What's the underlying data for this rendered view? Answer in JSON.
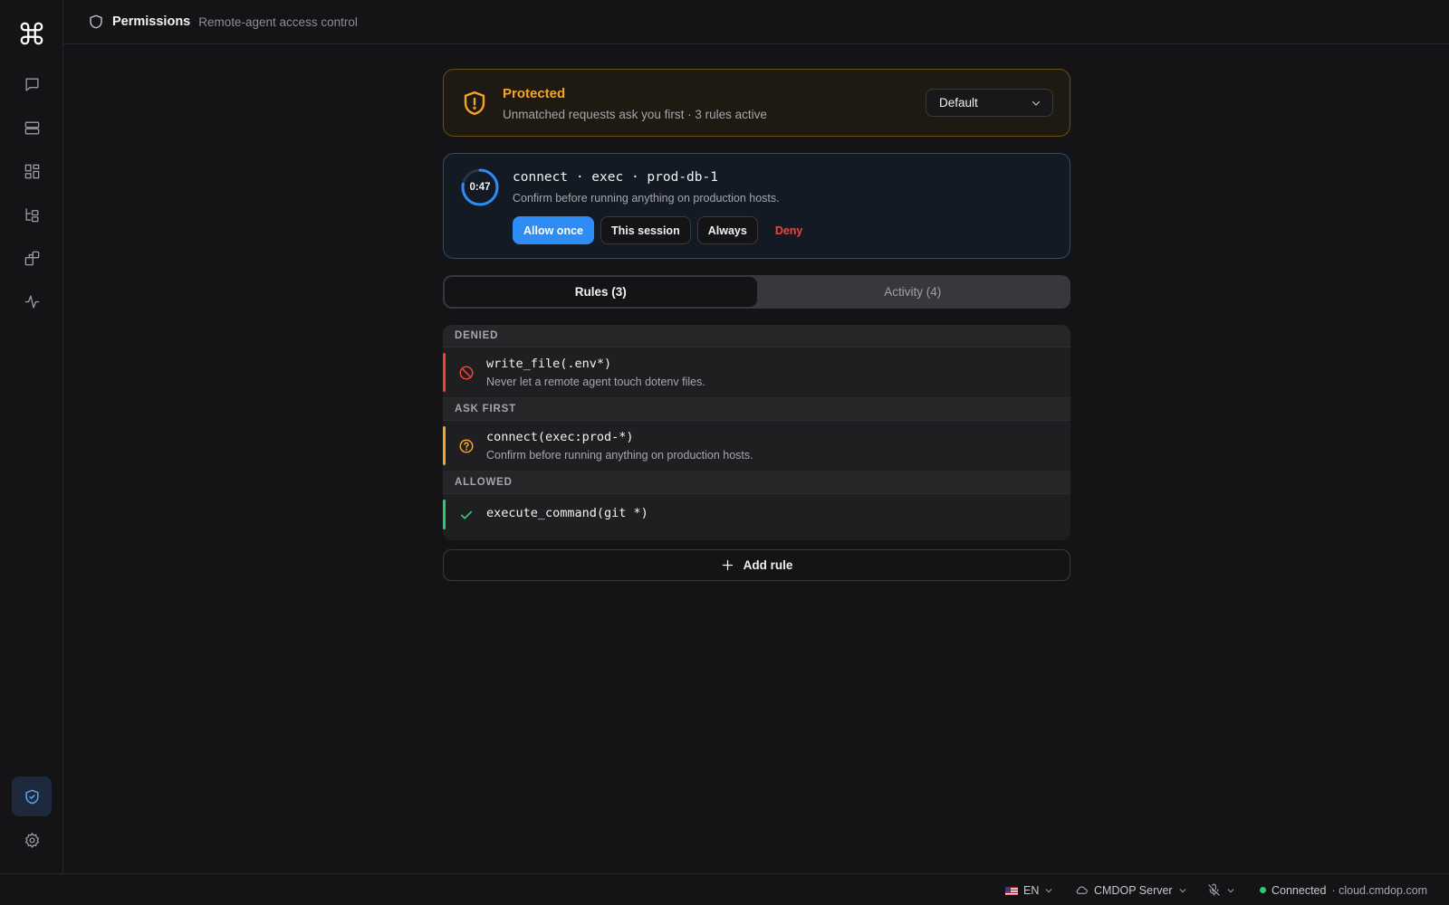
{
  "header": {
    "title": "Permissions",
    "subtitle": "Remote-agent access control"
  },
  "sidebar": {
    "items": [
      {
        "icon": "chat-icon"
      },
      {
        "icon": "server-icon"
      },
      {
        "icon": "dashboard-icon"
      },
      {
        "icon": "tree-icon"
      },
      {
        "icon": "plugins-icon"
      },
      {
        "icon": "activity-icon"
      }
    ],
    "bottom": [
      {
        "icon": "shield-check-icon",
        "active": true
      },
      {
        "icon": "gear-icon"
      }
    ]
  },
  "status": {
    "title": "Protected",
    "subtitle": "Unmatched requests ask you first · 3 rules active",
    "mode_value": "Default",
    "color": "#f5a524"
  },
  "request": {
    "timer": "0:47",
    "timer_fraction": 0.78,
    "title": "connect · exec · prod-db-1",
    "subtitle": "Confirm before running anything on production hosts.",
    "actions": {
      "allow_once": "Allow once",
      "this_session": "This session",
      "always": "Always",
      "deny": "Deny"
    },
    "accent": "#2f8cf5"
  },
  "tabs": [
    {
      "label": "Rules (3)",
      "active": true
    },
    {
      "label": "Activity (4)",
      "active": false
    }
  ],
  "rules": {
    "denied": {
      "label": "DENIED",
      "items": [
        {
          "pattern": "write_file(.env*)",
          "description": "Never let a remote agent touch dotenv files.",
          "color": "#f0443a"
        }
      ]
    },
    "ask_first": {
      "label": "ASK FIRST",
      "items": [
        {
          "pattern": "connect(exec:prod-*)",
          "description": "Confirm before running anything on production hosts.",
          "color": "#f5a524"
        }
      ]
    },
    "allowed": {
      "label": "ALLOWED",
      "items": [
        {
          "pattern": "execute_command(git *)",
          "description": "",
          "color": "#2ecc71"
        }
      ]
    }
  },
  "add_rule_label": "Add rule",
  "footer": {
    "language": "EN",
    "server": "CMDOP Server",
    "connection_status": "Connected",
    "connection_host": "· cloud.cmdop.com"
  }
}
